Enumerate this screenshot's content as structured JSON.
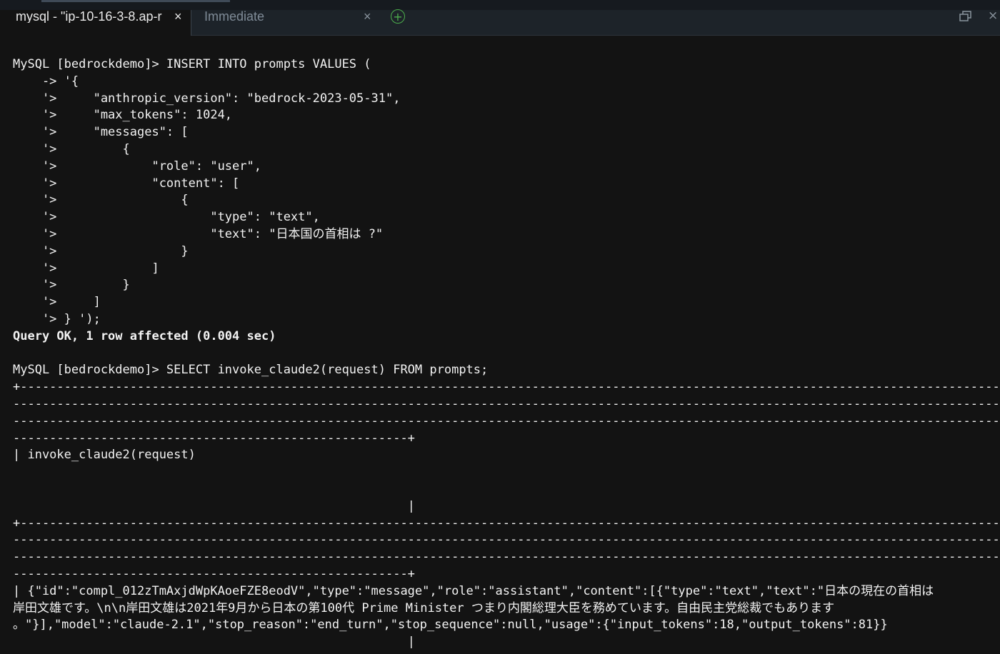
{
  "tabs": [
    {
      "title": "mysql - \"ip-10-16-3-8.ap-r",
      "close": "×"
    },
    {
      "title": "Immediate",
      "close": "×"
    }
  ],
  "add_tab_symbol": "+",
  "close_pane_symbol": "×",
  "colors": {
    "terminal_bg": "#131313",
    "terminal_fg": "#f2f2f2",
    "tabbar_bg": "#1d2329",
    "add_tab_accent": "#4cae4c"
  },
  "icons": {
    "add_tab": "plus-circle-icon",
    "restore": "window-restore-icon",
    "close_pane": "close-icon"
  },
  "terminal": {
    "lines": [
      "MySQL [bedrockdemo]> INSERT INTO prompts VALUES (",
      "    -> '{",
      "    '>     \"anthropic_version\": \"bedrock-2023-05-31\",",
      "    '>     \"max_tokens\": 1024,",
      "    '>     \"messages\": [",
      "    '>         {",
      "    '>             \"role\": \"user\",",
      "    '>             \"content\": [",
      "    '>                 {",
      "    '>                     \"type\": \"text\",",
      "    '>                     \"text\": \"日本国の首相は ?\"",
      "    '>                 }",
      "    '>             ]",
      "    '>         }",
      "    '>     ]",
      "    '> } ');",
      "Query OK, 1 row affected (0.004 sec)",
      "",
      "MySQL [bedrockdemo]> SELECT invoke_claude2(request) FROM prompts;",
      "+--------------------------------------------------------------------------------------------------------------------------------------------",
      "--------------------------------------------------------------------------------------------------------------------------------------------",
      "--------------------------------------------------------------------------------------------------------------------------------------------",
      "------------------------------------------------------+",
      "| invoke_claude2(request)",
      "",
      "",
      "                                                      |",
      "+--------------------------------------------------------------------------------------------------------------------------------------------",
      "--------------------------------------------------------------------------------------------------------------------------------------------",
      "--------------------------------------------------------------------------------------------------------------------------------------------",
      "------------------------------------------------------+",
      "| {\"id\":\"compl_012zTmAxjdWpKAoeFZE8eodV\",\"type\":\"message\",\"role\":\"assistant\",\"content\":[{\"type\":\"text\",\"text\":\"日本の現在の首相は",
      "岸田文雄です。\\n\\n岸田文雄は2021年9月から日本の第100代 Prime Minister つまり内閣総理大臣を務めています。自由民主党総裁でもあります",
      "。\"}],\"model\":\"claude-2.1\",\"stop_reason\":\"end_turn\",\"stop_sequence\":null,\"usage\":{\"input_tokens\":18,\"output_tokens\":81}}",
      "                                                      |"
    ]
  }
}
